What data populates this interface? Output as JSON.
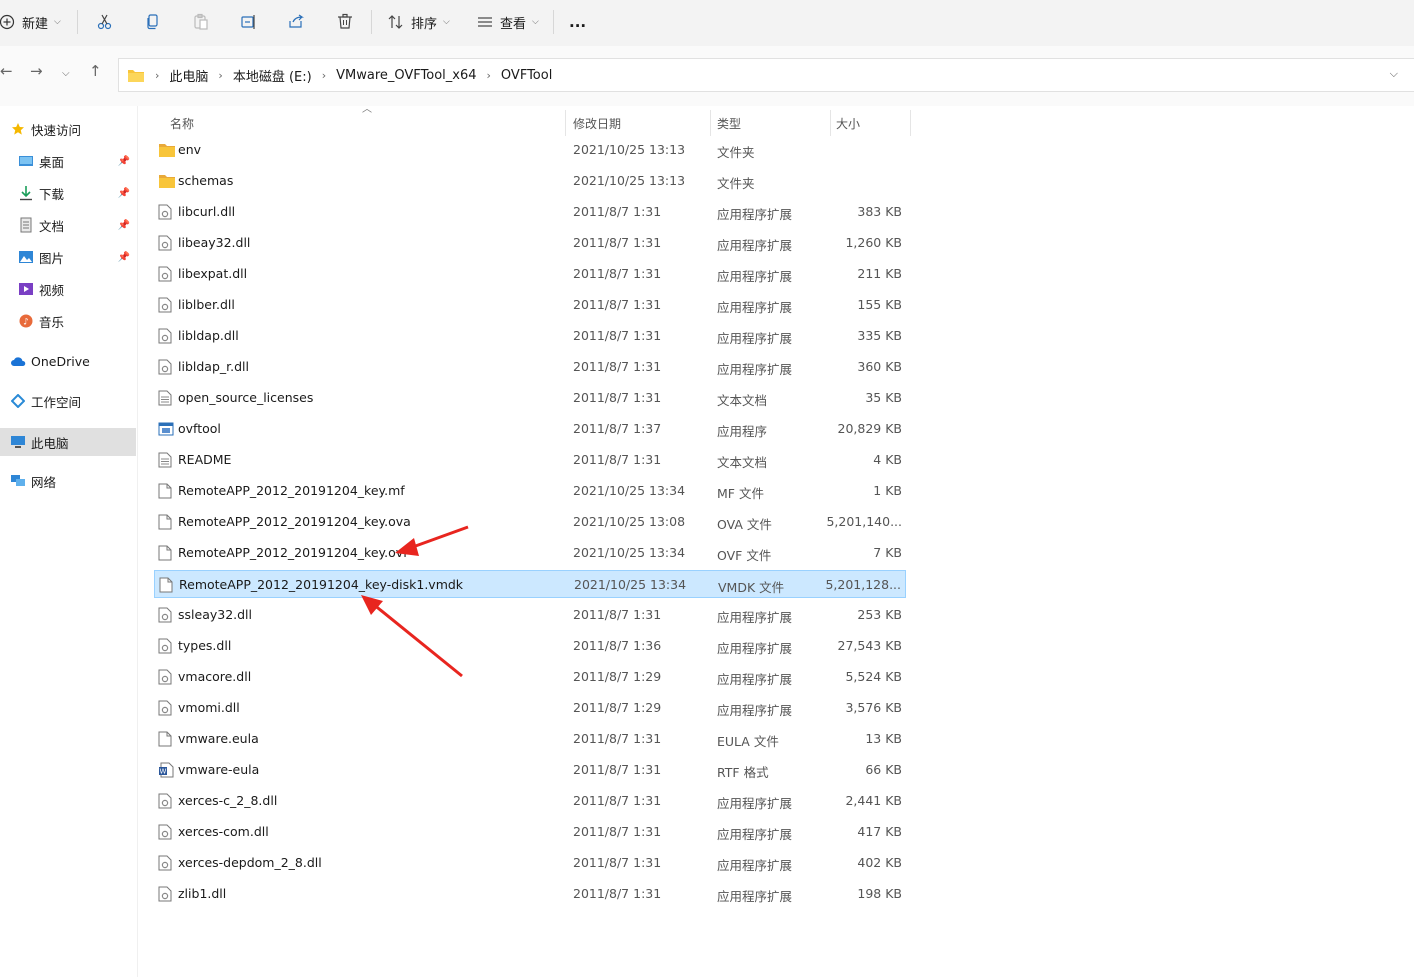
{
  "toolbar": {
    "new_label": "新建",
    "sort_label": "排序",
    "view_label": "查看",
    "more_label": "..."
  },
  "address": {
    "crumbs": [
      "此电脑",
      "本地磁盘 (E:)",
      "VMware_OVFTool_x64",
      "OVFTool"
    ]
  },
  "sidebar": {
    "items": [
      {
        "label": "快速访问",
        "icon": "star-icon"
      },
      {
        "label": "桌面",
        "icon": "desktop-icon",
        "pinned": true
      },
      {
        "label": "下载",
        "icon": "download-icon",
        "pinned": true
      },
      {
        "label": "文档",
        "icon": "document-icon",
        "pinned": true
      },
      {
        "label": "图片",
        "icon": "picture-icon",
        "pinned": true
      },
      {
        "label": "视频",
        "icon": "video-icon"
      },
      {
        "label": "音乐",
        "icon": "music-icon"
      },
      {
        "label": "OneDrive",
        "icon": "cloud-icon"
      },
      {
        "label": "工作空间",
        "icon": "workspace-icon"
      },
      {
        "label": "此电脑",
        "icon": "computer-icon",
        "selected": true
      },
      {
        "label": "网络",
        "icon": "network-icon"
      }
    ]
  },
  "columns": {
    "name": "名称",
    "date": "修改日期",
    "type": "类型",
    "size": "大小"
  },
  "files": [
    {
      "name": "env",
      "date": "2021/10/25 13:13",
      "type": "文件夹",
      "size": "",
      "icon": "folder"
    },
    {
      "name": "schemas",
      "date": "2021/10/25 13:13",
      "type": "文件夹",
      "size": "",
      "icon": "folder"
    },
    {
      "name": "libcurl.dll",
      "date": "2011/8/7 1:31",
      "type": "应用程序扩展",
      "size": "383 KB",
      "icon": "dll"
    },
    {
      "name": "libeay32.dll",
      "date": "2011/8/7 1:31",
      "type": "应用程序扩展",
      "size": "1,260 KB",
      "icon": "dll"
    },
    {
      "name": "libexpat.dll",
      "date": "2011/8/7 1:31",
      "type": "应用程序扩展",
      "size": "211 KB",
      "icon": "dll"
    },
    {
      "name": "liblber.dll",
      "date": "2011/8/7 1:31",
      "type": "应用程序扩展",
      "size": "155 KB",
      "icon": "dll"
    },
    {
      "name": "libldap.dll",
      "date": "2011/8/7 1:31",
      "type": "应用程序扩展",
      "size": "335 KB",
      "icon": "dll"
    },
    {
      "name": "libldap_r.dll",
      "date": "2011/8/7 1:31",
      "type": "应用程序扩展",
      "size": "360 KB",
      "icon": "dll"
    },
    {
      "name": "open_source_licenses",
      "date": "2011/8/7 1:31",
      "type": "文本文档",
      "size": "35 KB",
      "icon": "text"
    },
    {
      "name": "ovftool",
      "date": "2011/8/7 1:37",
      "type": "应用程序",
      "size": "20,829 KB",
      "icon": "exe"
    },
    {
      "name": "README",
      "date": "2011/8/7 1:31",
      "type": "文本文档",
      "size": "4 KB",
      "icon": "text"
    },
    {
      "name": "RemoteAPP_2012_20191204_key.mf",
      "date": "2021/10/25 13:34",
      "type": "MF 文件",
      "size": "1 KB",
      "icon": "file"
    },
    {
      "name": "RemoteAPP_2012_20191204_key.ova",
      "date": "2021/10/25 13:08",
      "type": "OVA 文件",
      "size": "5,201,140...",
      "icon": "file"
    },
    {
      "name": "RemoteAPP_2012_20191204_key.ovf",
      "date": "2021/10/25 13:34",
      "type": "OVF 文件",
      "size": "7 KB",
      "icon": "file"
    },
    {
      "name": "RemoteAPP_2012_20191204_key-disk1.vmdk",
      "date": "2021/10/25 13:34",
      "type": "VMDK 文件",
      "size": "5,201,128...",
      "icon": "file",
      "selected": true
    },
    {
      "name": "ssleay32.dll",
      "date": "2011/8/7 1:31",
      "type": "应用程序扩展",
      "size": "253 KB",
      "icon": "dll"
    },
    {
      "name": "types.dll",
      "date": "2011/8/7 1:36",
      "type": "应用程序扩展",
      "size": "27,543 KB",
      "icon": "dll"
    },
    {
      "name": "vmacore.dll",
      "date": "2011/8/7 1:29",
      "type": "应用程序扩展",
      "size": "5,524 KB",
      "icon": "dll"
    },
    {
      "name": "vmomi.dll",
      "date": "2011/8/7 1:29",
      "type": "应用程序扩展",
      "size": "3,576 KB",
      "icon": "dll"
    },
    {
      "name": "vmware.eula",
      "date": "2011/8/7 1:31",
      "type": "EULA 文件",
      "size": "13 KB",
      "icon": "file"
    },
    {
      "name": "vmware-eula",
      "date": "2011/8/7 1:31",
      "type": "RTF 格式",
      "size": "66 KB",
      "icon": "rtf"
    },
    {
      "name": "xerces-c_2_8.dll",
      "date": "2011/8/7 1:31",
      "type": "应用程序扩展",
      "size": "2,441 KB",
      "icon": "dll"
    },
    {
      "name": "xerces-com.dll",
      "date": "2011/8/7 1:31",
      "type": "应用程序扩展",
      "size": "417 KB",
      "icon": "dll"
    },
    {
      "name": "xerces-depdom_2_8.dll",
      "date": "2011/8/7 1:31",
      "type": "应用程序扩展",
      "size": "402 KB",
      "icon": "dll"
    },
    {
      "name": "zlib1.dll",
      "date": "2011/8/7 1:31",
      "type": "应用程序扩展",
      "size": "198 KB",
      "icon": "dll"
    }
  ],
  "colors": {
    "selection": "#cce8ff",
    "folder": "#f8c53a",
    "annotation_arrow": "#e8251f"
  }
}
